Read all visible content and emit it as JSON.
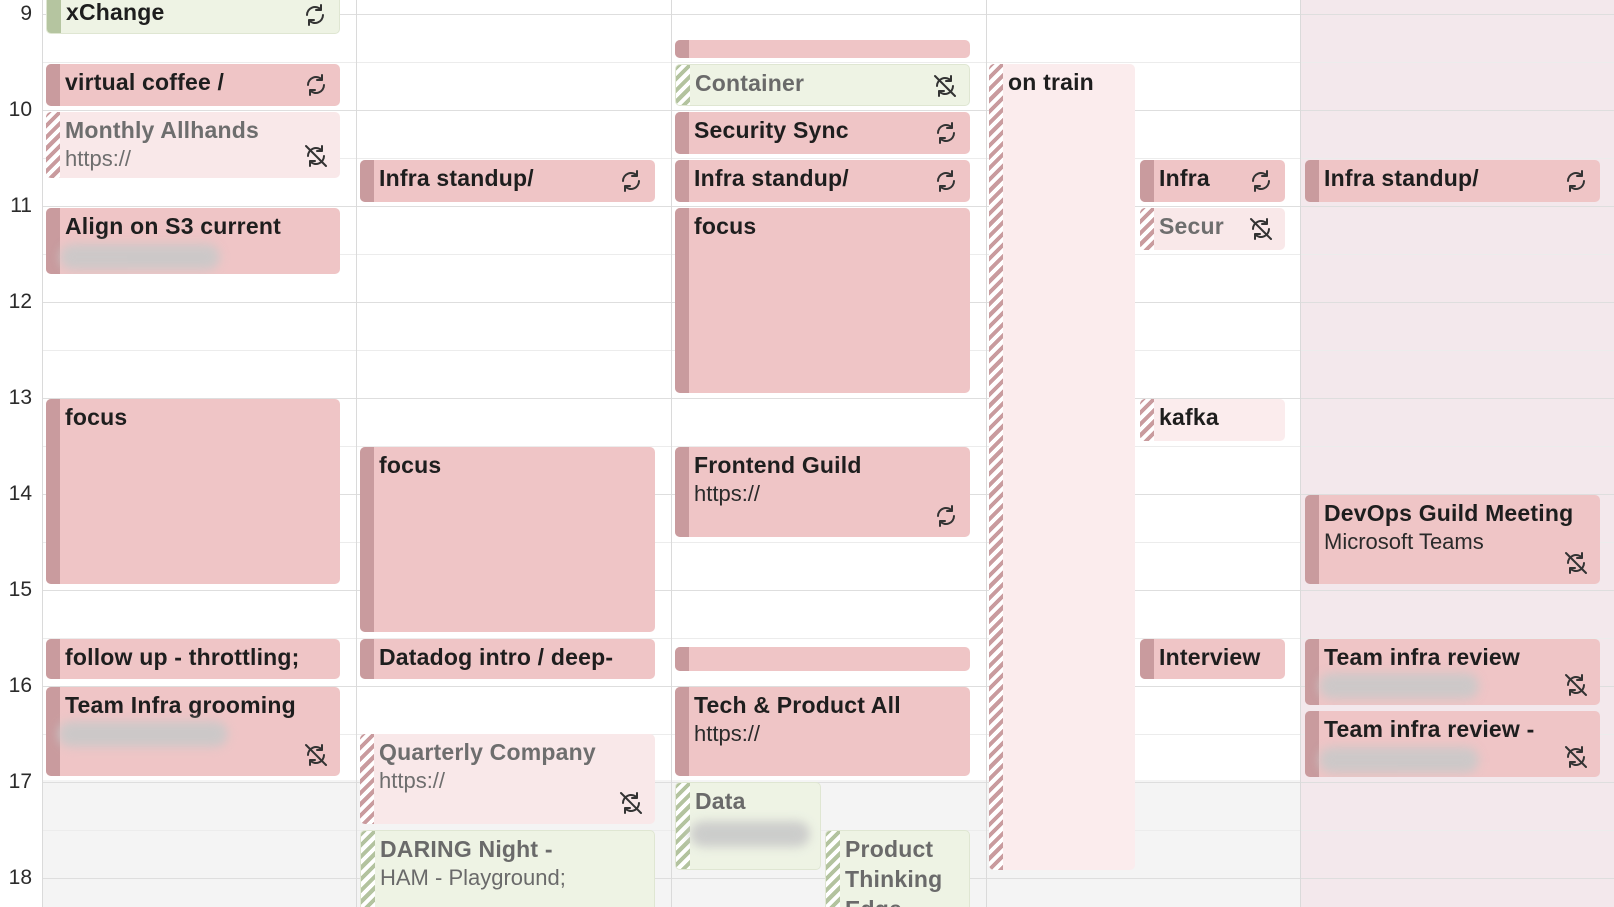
{
  "hours": [
    "9",
    "10",
    "11",
    "12",
    "13",
    "14",
    "15",
    "16",
    "17",
    "18"
  ],
  "colors": {
    "event_pink": "#efc5c6",
    "event_pink_bar": "#c99b9e",
    "tentative_pink": "#f9e8e9",
    "green": "#eef3e4",
    "weekend_shade": "#f3e8ec"
  },
  "days": [
    {
      "events": [
        {
          "title": "xChange",
          "icon": "repeat-icon"
        },
        {
          "title": "virtual coffee /",
          "icon": "repeat-icon"
        },
        {
          "title": "Monthly Allhands",
          "sub": "https://",
          "icon": "repeat-off-icon"
        },
        {
          "title": "Align on S3 current"
        },
        {
          "title": "focus"
        },
        {
          "title": "follow up - throttling;"
        },
        {
          "title": "Team Infra grooming",
          "icon": "repeat-off-icon"
        }
      ]
    },
    {
      "events": [
        {
          "title": "Infra standup/",
          "icon": "repeat-icon"
        },
        {
          "title": "focus"
        },
        {
          "title": "Datadog intro / deep-"
        },
        {
          "title": "Quarterly Company",
          "sub": "https://",
          "icon": "repeat-off-icon"
        },
        {
          "title": "DARING Night -",
          "sub": "HAM - Playground;"
        }
      ]
    },
    {
      "events": [
        {
          "title": ""
        },
        {
          "title": "Container",
          "icon": "repeat-off-icon"
        },
        {
          "title": "Security Sync",
          "icon": "repeat-icon"
        },
        {
          "title": "Infra standup/",
          "icon": "repeat-icon"
        },
        {
          "title": "focus"
        },
        {
          "title": "Frontend Guild",
          "sub": "https://",
          "icon": "repeat-icon"
        },
        {
          "title": ""
        },
        {
          "title": "Tech & Product All",
          "sub": "https://"
        },
        {
          "title": "Data"
        },
        {
          "title": "Product",
          "sub": "Thinking",
          "sub2": "Edge"
        }
      ]
    },
    {
      "events": [
        {
          "title": "on train"
        },
        {
          "title": "Infra",
          "icon": "repeat-icon"
        },
        {
          "title": "Secur",
          "icon": "repeat-off-icon"
        },
        {
          "title": "kafka"
        },
        {
          "title": "Interview"
        }
      ]
    },
    {
      "events": [
        {
          "title": "Infra standup/",
          "icon": "repeat-icon"
        },
        {
          "title": "DevOps Guild Meeting",
          "sub": "Microsoft Teams",
          "icon": "repeat-off-icon"
        },
        {
          "title": "Team infra review",
          "icon": "repeat-off-icon"
        },
        {
          "title": "Team infra review -",
          "icon": "repeat-off-icon"
        }
      ]
    }
  ]
}
